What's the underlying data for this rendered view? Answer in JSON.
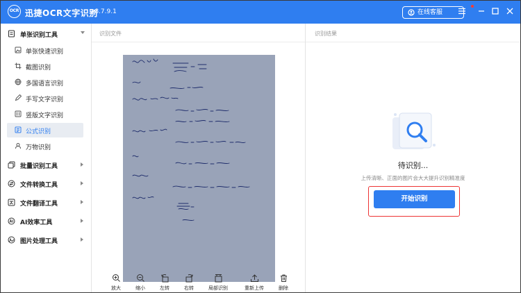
{
  "header": {
    "logo_text": "OCR",
    "app_title": "迅捷OCR文字识别",
    "version": "v8.7.9.1",
    "service_label": "在线客服"
  },
  "sidebar": {
    "groups": [
      {
        "label": "单张识别工具",
        "expanded": true
      },
      {
        "label": "批量识别工具"
      },
      {
        "label": "文件转换工具"
      },
      {
        "label": "文件翻译工具"
      },
      {
        "label": "AI效率工具"
      },
      {
        "label": "图片处理工具"
      }
    ],
    "items": [
      {
        "label": "单张快速识别"
      },
      {
        "label": "截图识别"
      },
      {
        "label": "多国语言识别"
      },
      {
        "label": "手写文字识别"
      },
      {
        "label": "竖版文字识别"
      },
      {
        "label": "公式识别",
        "active": true
      },
      {
        "label": "万物识别"
      }
    ]
  },
  "main": {
    "panel_title": "识别文件",
    "toolbar": [
      {
        "label": "放大",
        "icon": "zoom-in-icon"
      },
      {
        "label": "缩小",
        "icon": "zoom-out-icon"
      },
      {
        "label": "左转",
        "icon": "rotate-left-icon"
      },
      {
        "label": "右转",
        "icon": "rotate-right-icon"
      },
      {
        "label": "局部识别",
        "icon": "crop-icon"
      },
      {
        "label": "重新上传",
        "icon": "upload-icon"
      },
      {
        "label": "删除",
        "icon": "trash-icon"
      }
    ]
  },
  "result": {
    "panel_title": "识别结果",
    "status": "待识别...",
    "hint": "上传清晰、正面的图片会大大提升识别精准度",
    "start_button": "开始识别"
  },
  "colors": {
    "accent": "#2f7ef0",
    "highlight_border": "#e33333"
  }
}
